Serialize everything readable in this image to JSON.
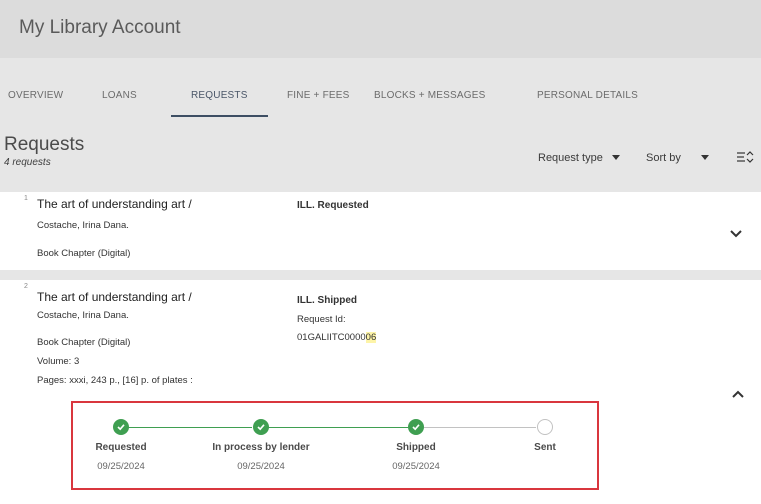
{
  "header": {
    "title": "My Library Account"
  },
  "tabs": [
    {
      "label": "OVERVIEW"
    },
    {
      "label": "LOANS"
    },
    {
      "label": "REQUESTS"
    },
    {
      "label": "FINE + FEES"
    },
    {
      "label": "BLOCKS + MESSAGES"
    },
    {
      "label": "PERSONAL DETAILS"
    }
  ],
  "active_tab": "REQUESTS",
  "requests": {
    "title": "Requests",
    "count": "4 requests",
    "request_type_label": "Request type",
    "sort_by_label": "Sort by"
  },
  "items": [
    {
      "index": "1",
      "title": "The art of understanding art /",
      "author": "Costache, Irina Dana.",
      "format": "Book Chapter (Digital)",
      "status": "ILL. Requested"
    },
    {
      "index": "2",
      "title": "The art of understanding art /",
      "author": "Costache, Irina Dana.",
      "format": "Book Chapter (Digital)",
      "volume": "Volume: 3",
      "pages": "Pages: xxxi, 243 p., [16] p. of plates :",
      "status": "ILL. Shipped",
      "request_id_label": "Request Id:",
      "request_id_prefix": "01GALIITC0000",
      "request_id_highlight": "06"
    }
  ],
  "tracker": {
    "steps": [
      {
        "label": "Requested",
        "date": "09/25/2024",
        "done": true
      },
      {
        "label": "In process by lender",
        "date": "09/25/2024",
        "done": true
      },
      {
        "label": "Shipped",
        "date": "09/25/2024",
        "done": true
      },
      {
        "label": "Sent",
        "date": "",
        "done": false
      }
    ]
  },
  "colors": {
    "accent": "#3d4e63",
    "done": "#3f9f51",
    "highlight_border": "#d9363e"
  }
}
